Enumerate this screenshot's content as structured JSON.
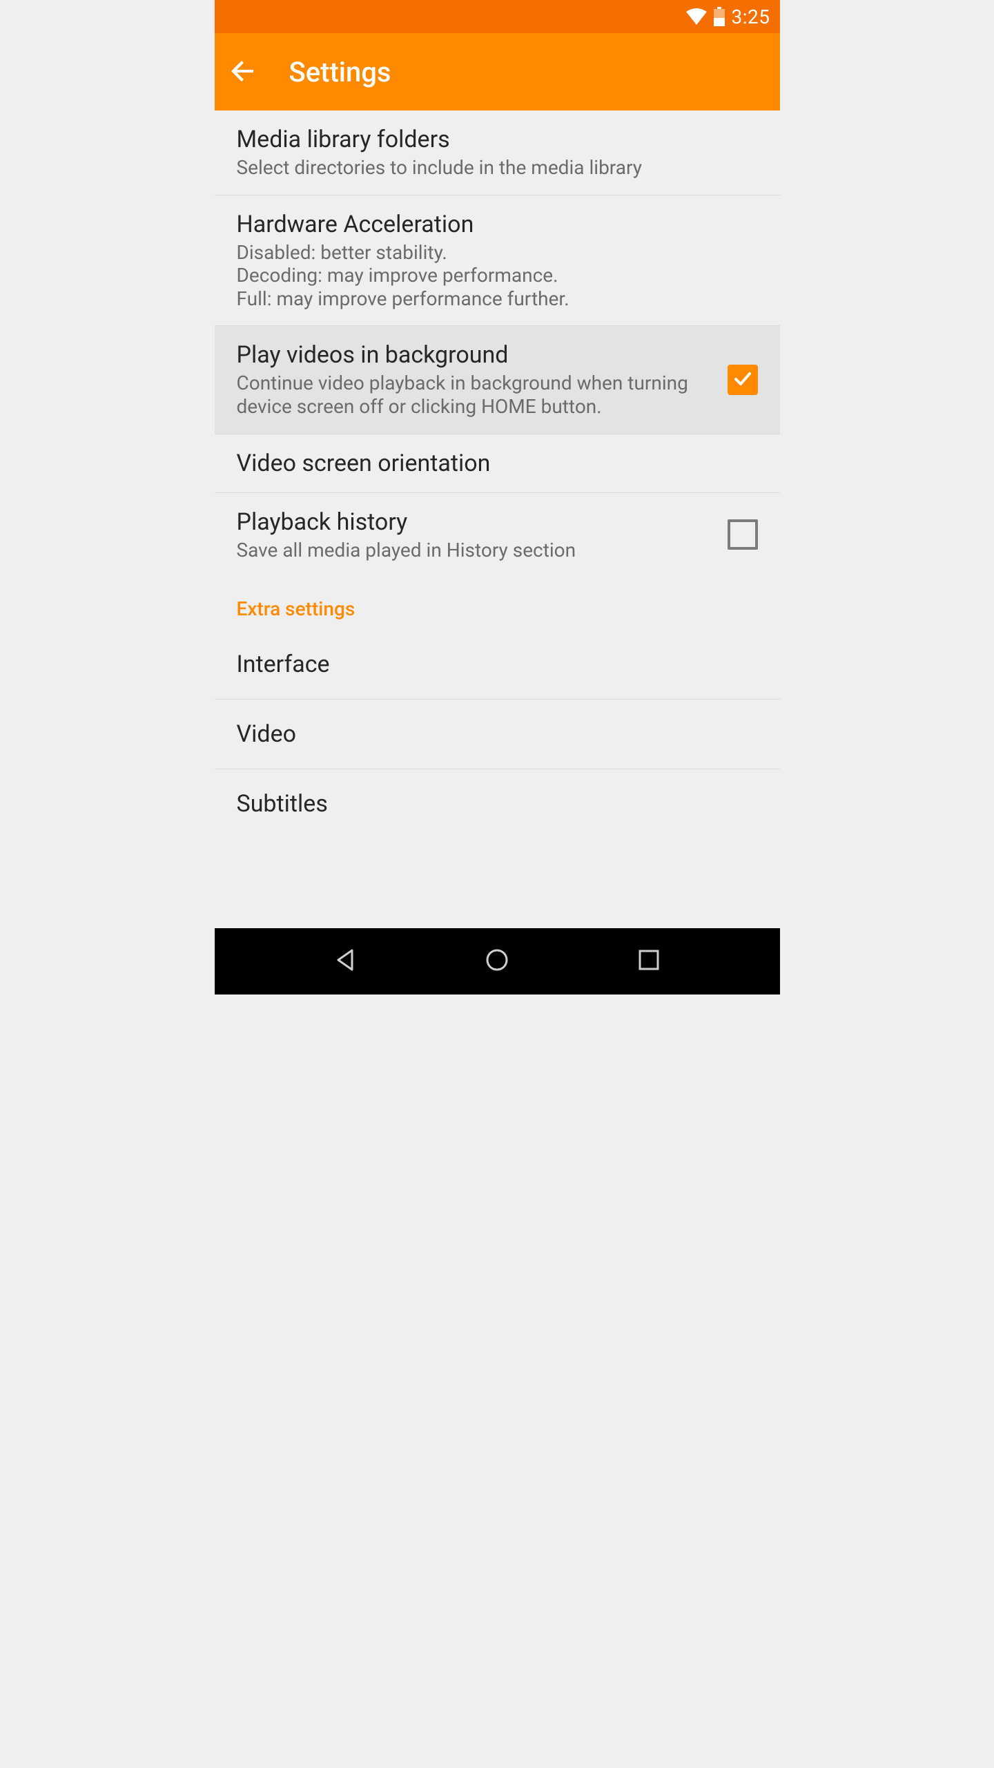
{
  "colors": {
    "status_bar": "#f56f00",
    "app_bar": "#ff8a00",
    "accent": "#ff8a00"
  },
  "status": {
    "time": "3:25"
  },
  "app_bar": {
    "title": "Settings"
  },
  "settings": {
    "media_library": {
      "title": "Media library folders",
      "subtitle": "Select directories to include in the media library"
    },
    "hardware_accel": {
      "title": "Hardware Acceleration",
      "subtitle": "Disabled: better stability.\nDecoding: may improve performance.\nFull: may improve performance further."
    },
    "play_bg": {
      "title": "Play videos in background",
      "subtitle": "Continue video playback in background when turning device screen off or clicking HOME button.",
      "checked": true
    },
    "video_orientation": {
      "title": "Video screen orientation"
    },
    "playback_history": {
      "title": "Playback history",
      "subtitle": "Save all media played in History section",
      "checked": false
    }
  },
  "section_extra": {
    "header": "Extra settings",
    "items": {
      "interface": "Interface",
      "video": "Video",
      "subtitles": "Subtitles"
    }
  }
}
